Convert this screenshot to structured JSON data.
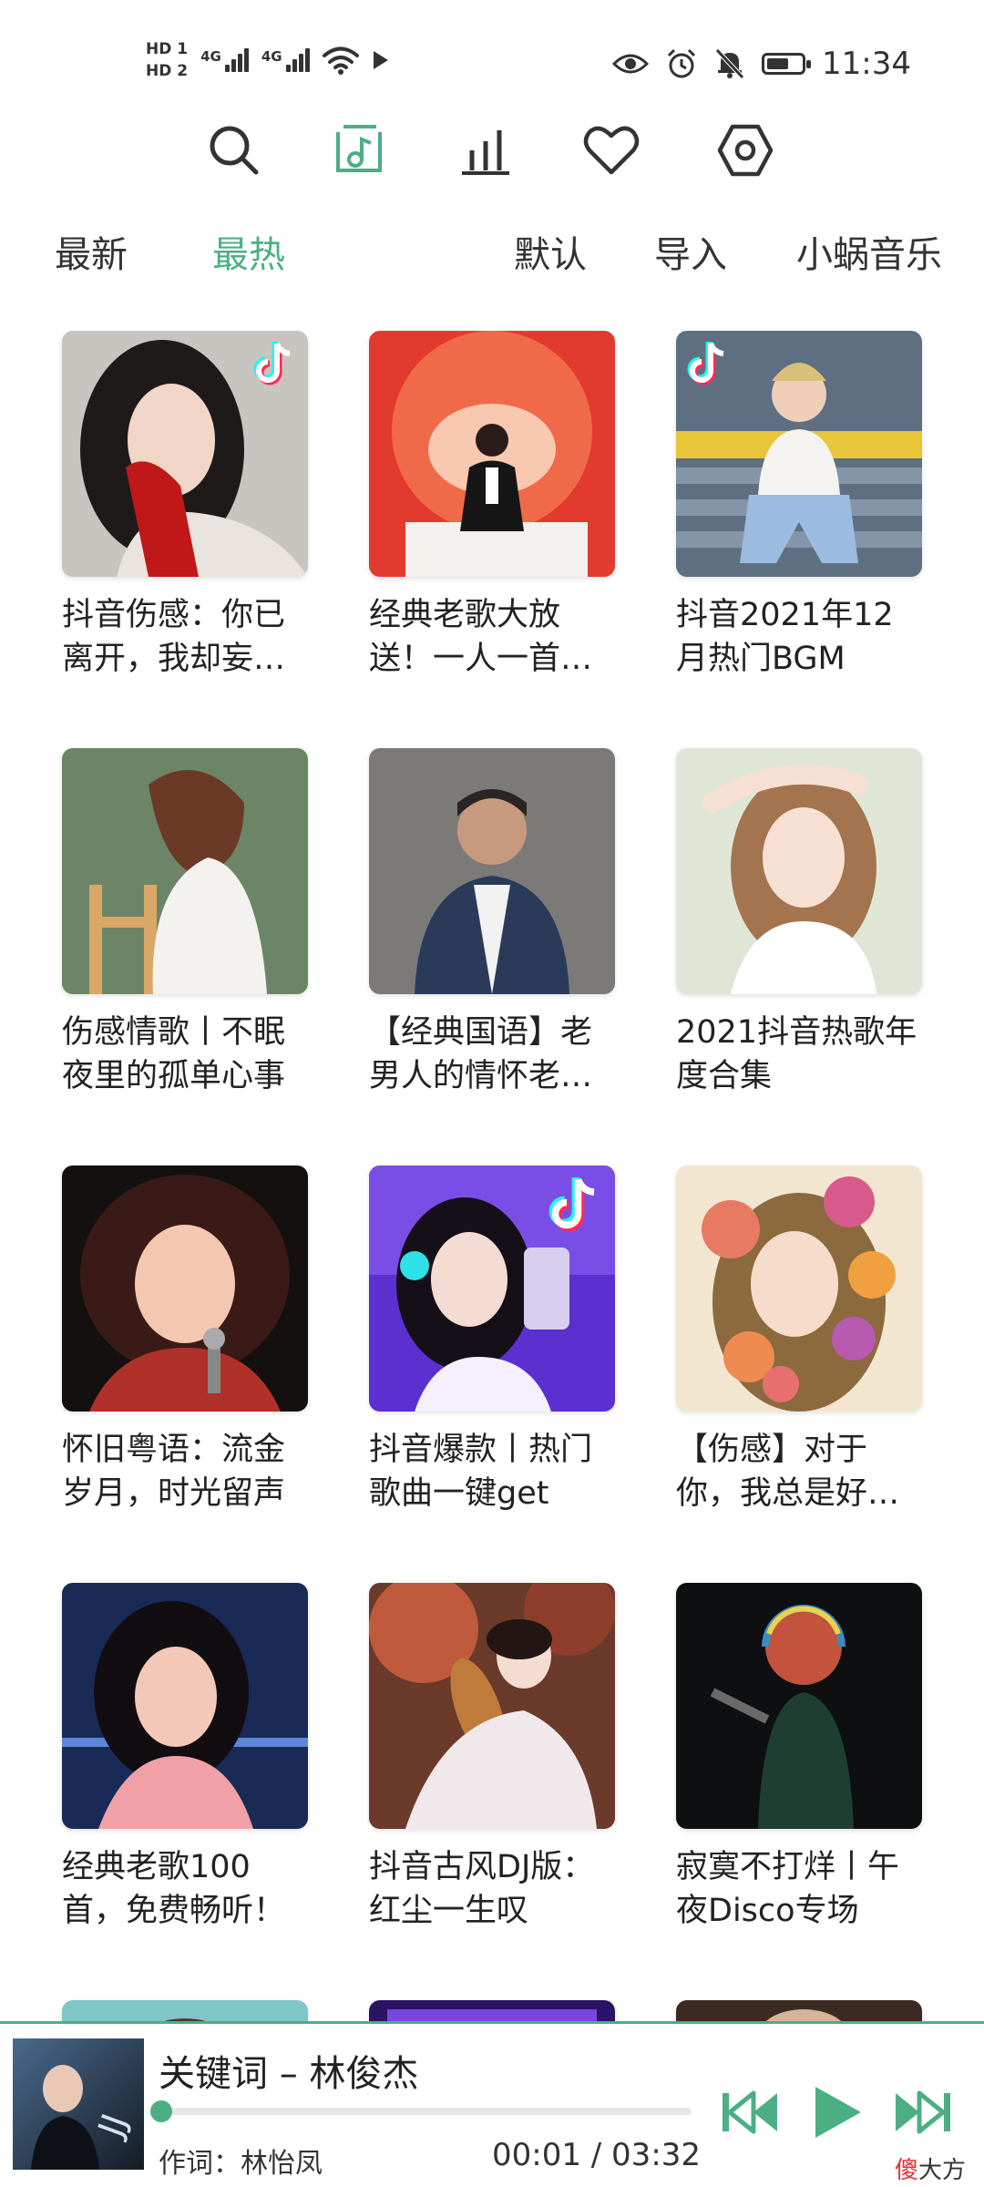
{
  "status_bar": {
    "hd1": "HD 1",
    "hd2": "HD 2",
    "net1": "4G",
    "net2": "4G",
    "time": "11:34",
    "battery_level": 0.65
  },
  "toolbar": {
    "icons": [
      "search-icon",
      "music-note-icon",
      "bar-chart-icon",
      "heart-icon",
      "settings-icon"
    ],
    "accent": "#4caf84"
  },
  "tabs": [
    "最新",
    "最热",
    "默认",
    "导入",
    "小蜗音乐"
  ],
  "active_tab": "最热",
  "playlists": [
    {
      "title": "抖音伤感：你已离开，我却妄…"
    },
    {
      "title": "经典老歌大放送！一人一首…"
    },
    {
      "title": "抖音2021年12月热门BGM"
    },
    {
      "title": "伤感情歌丨不眠夜里的孤单心事"
    },
    {
      "title": "【经典国语】老男人的情怀老…"
    },
    {
      "title": "2021抖音热歌年度合集"
    },
    {
      "title": "怀旧粤语：流金岁月，时光留声"
    },
    {
      "title": "抖音爆款丨热门歌曲一键get"
    },
    {
      "title": "【伤感】对于你，我总是好…"
    },
    {
      "title": "经典老歌100首，免费畅听！"
    },
    {
      "title": "抖音古风DJ版：红尘一生叹"
    },
    {
      "title": "寂寞不打烊丨午夜Disco专场"
    }
  ],
  "player": {
    "song": "关键词 – 林俊杰",
    "lyric_line": "作词：林怡凤",
    "time": "00:01 / 03:32",
    "progress": 0.005,
    "brand_red": "傻",
    "brand_rest": "大方"
  }
}
